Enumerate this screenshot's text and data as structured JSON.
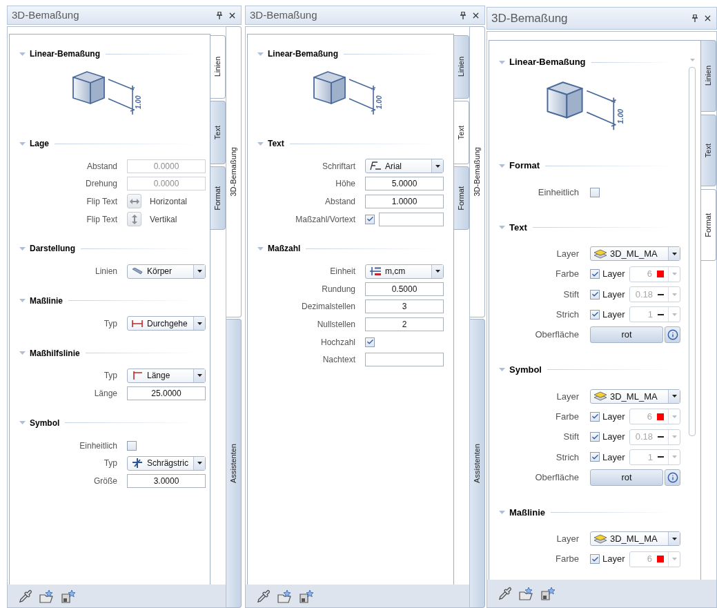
{
  "panels": [
    {
      "title": "3D-Bemaßung",
      "tabs": [
        {
          "label": "Linien",
          "selected": true
        },
        {
          "label": "Text",
          "selected": false
        },
        {
          "label": "Format",
          "selected": false
        }
      ],
      "outer_tabs": [
        {
          "label": "3D-Bemaßung",
          "selected": true
        },
        {
          "label": "Assistenten",
          "selected": false
        }
      ],
      "sections": [
        {
          "title": "Linear-Bemaßung",
          "expanded": true,
          "figure": {
            "dimension_label": "1.00"
          }
        },
        {
          "title": "Lage",
          "expanded": true,
          "rows": [
            {
              "kind": "input",
              "label": "Abstand",
              "value": "0.0000",
              "disabled": true
            },
            {
              "kind": "input",
              "label": "Drehung",
              "value": "0.0000",
              "disabled": true
            },
            {
              "kind": "flip",
              "label": "Flip Text",
              "text": "Horizontal"
            },
            {
              "kind": "flip",
              "label": "Flip Text",
              "text": "Vertikal"
            }
          ]
        },
        {
          "title": "Darstellung",
          "expanded": true,
          "rows": [
            {
              "kind": "dropdown",
              "label": "Linien",
              "value": "Körper"
            }
          ]
        },
        {
          "title": "Maßlinie",
          "expanded": true,
          "rows": [
            {
              "kind": "dropdown",
              "label": "Typ",
              "value": "Durchgehe"
            }
          ]
        },
        {
          "title": "Maßhilfslinie",
          "expanded": true,
          "rows": [
            {
              "kind": "dropdown",
              "label": "Typ",
              "value": "Länge"
            },
            {
              "kind": "input",
              "label": "Länge",
              "value": "25.0000",
              "disabled": false
            }
          ]
        },
        {
          "title": "Symbol",
          "expanded": true,
          "rows": [
            {
              "kind": "checkbox",
              "label": "Einheitlich",
              "checked": false
            },
            {
              "kind": "dropdown",
              "label": "Typ",
              "value": "Schrägstric"
            },
            {
              "kind": "input",
              "label": "Größe",
              "value": "3.0000",
              "disabled": false
            }
          ]
        }
      ]
    },
    {
      "title": "3D-Bemaßung",
      "tabs": [
        {
          "label": "Linien",
          "selected": false
        },
        {
          "label": "Text",
          "selected": true
        },
        {
          "label": "Format",
          "selected": false
        }
      ],
      "outer_tabs": [
        {
          "label": "3D-Bemaßung",
          "selected": true
        },
        {
          "label": "Assistenten",
          "selected": false
        }
      ],
      "sections": [
        {
          "title": "Linear-Bemaßung",
          "expanded": true,
          "figure": {
            "dimension_label": "1.00"
          }
        },
        {
          "title": "Text",
          "expanded": true,
          "rows": [
            {
              "kind": "dropdown",
              "label": "Schriftart",
              "value": "Arial"
            },
            {
              "kind": "input",
              "label": "Höhe",
              "value": "5.0000",
              "disabled": false
            },
            {
              "kind": "input",
              "label": "Abstand",
              "value": "1.0000",
              "disabled": false
            },
            {
              "kind": "checkbox_input",
              "label": "Maßzahl/Vortext",
              "checked": true
            }
          ]
        },
        {
          "title": "Maßzahl",
          "expanded": true,
          "rows": [
            {
              "kind": "dropdown",
              "label": "Einheit",
              "value": "m,cm"
            },
            {
              "kind": "input",
              "label": "Rundung",
              "value": "0.5000",
              "disabled": false
            },
            {
              "kind": "input",
              "label": "Dezimalstellen",
              "value": "3",
              "disabled": false
            },
            {
              "kind": "input",
              "label": "Nullstellen",
              "value": "2",
              "disabled": false
            },
            {
              "kind": "checkbox",
              "label": "Hochzahl",
              "checked": true
            },
            {
              "kind": "input",
              "label": "Nachtext",
              "disabled": false
            }
          ]
        }
      ]
    },
    {
      "title": "3D-Bemaßung",
      "tabs": [
        {
          "label": "Linien",
          "selected": false
        },
        {
          "label": "Text",
          "selected": false
        },
        {
          "label": "Format",
          "selected": true
        }
      ],
      "sections": [
        {
          "title": "Linear-Bemaßung",
          "expanded": true,
          "figure": {
            "dimension_label": "1.00"
          }
        },
        {
          "title": "Format",
          "expanded": true,
          "rows": [
            {
              "kind": "checkbox",
              "label": "Einheitlich",
              "checked": false
            }
          ]
        },
        {
          "title": "Text",
          "expanded": true,
          "rows": [
            {
              "kind": "dropdown",
              "label": "Layer",
              "value": "3D_ML_MA"
            },
            {
              "kind": "layer_prop",
              "label": "Farbe",
              "checked": true,
              "check_label": "Layer",
              "value": "6",
              "color": "#ff0000"
            },
            {
              "kind": "layer_prop",
              "label": "Stift",
              "checked": true,
              "check_label": "Layer",
              "value": "0.18"
            },
            {
              "kind": "layer_prop",
              "label": "Strich",
              "checked": true,
              "check_label": "Layer",
              "value": "1"
            },
            {
              "kind": "button_info",
              "label": "Oberfläche",
              "button": "rot"
            }
          ]
        },
        {
          "title": "Symbol",
          "expanded": true,
          "rows": [
            {
              "kind": "dropdown",
              "label": "Layer",
              "value": "3D_ML_MA"
            },
            {
              "kind": "layer_prop",
              "label": "Farbe",
              "checked": true,
              "check_label": "Layer",
              "value": "6",
              "color": "#ff0000"
            },
            {
              "kind": "layer_prop",
              "label": "Stift",
              "checked": true,
              "check_label": "Layer",
              "value": "0.18"
            },
            {
              "kind": "layer_prop",
              "label": "Strich",
              "checked": true,
              "check_label": "Layer",
              "value": "1"
            },
            {
              "kind": "button_info",
              "label": "Oberfläche",
              "button": "rot"
            }
          ]
        },
        {
          "title": "Maßlinie",
          "expanded": true,
          "rows": [
            {
              "kind": "dropdown",
              "label": "Layer",
              "value": "3D_ML_MA"
            },
            {
              "kind": "layer_prop",
              "label": "Farbe",
              "checked": true,
              "check_label": "Layer",
              "value": "6",
              "color": "#ff0000"
            }
          ]
        }
      ]
    }
  ]
}
